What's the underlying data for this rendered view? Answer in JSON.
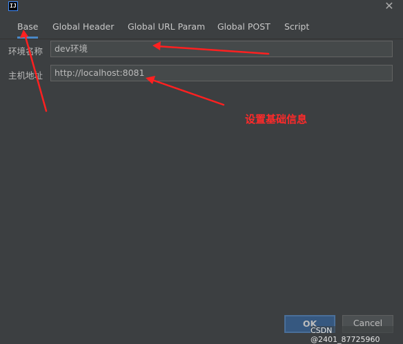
{
  "titlebar": {
    "app_icon_text": "IJ",
    "close_glyph": "✕"
  },
  "tabs": [
    {
      "label": "Base",
      "active": true
    },
    {
      "label": "Global Header",
      "active": false
    },
    {
      "label": "Global URL Param",
      "active": false
    },
    {
      "label": "Global POST",
      "active": false
    },
    {
      "label": "Script",
      "active": false
    }
  ],
  "form": {
    "env_name": {
      "label": "环境名称",
      "value": "dev环境"
    },
    "host_address": {
      "label": "主机地址",
      "value": "http://localhost:8081"
    }
  },
  "annotation": {
    "text": "设置基础信息",
    "color": "#ff2a2a"
  },
  "buttons": {
    "ok": "OK",
    "cancel": "Cancel"
  },
  "watermark": "CSDN @2401_87725960",
  "colors": {
    "background": "#3c3f41",
    "accent": "#4a88c7",
    "ok_button": "#365880",
    "arrow": "#ff2020"
  },
  "icons": {
    "app": "intellij-logo-icon",
    "close": "close-icon"
  }
}
